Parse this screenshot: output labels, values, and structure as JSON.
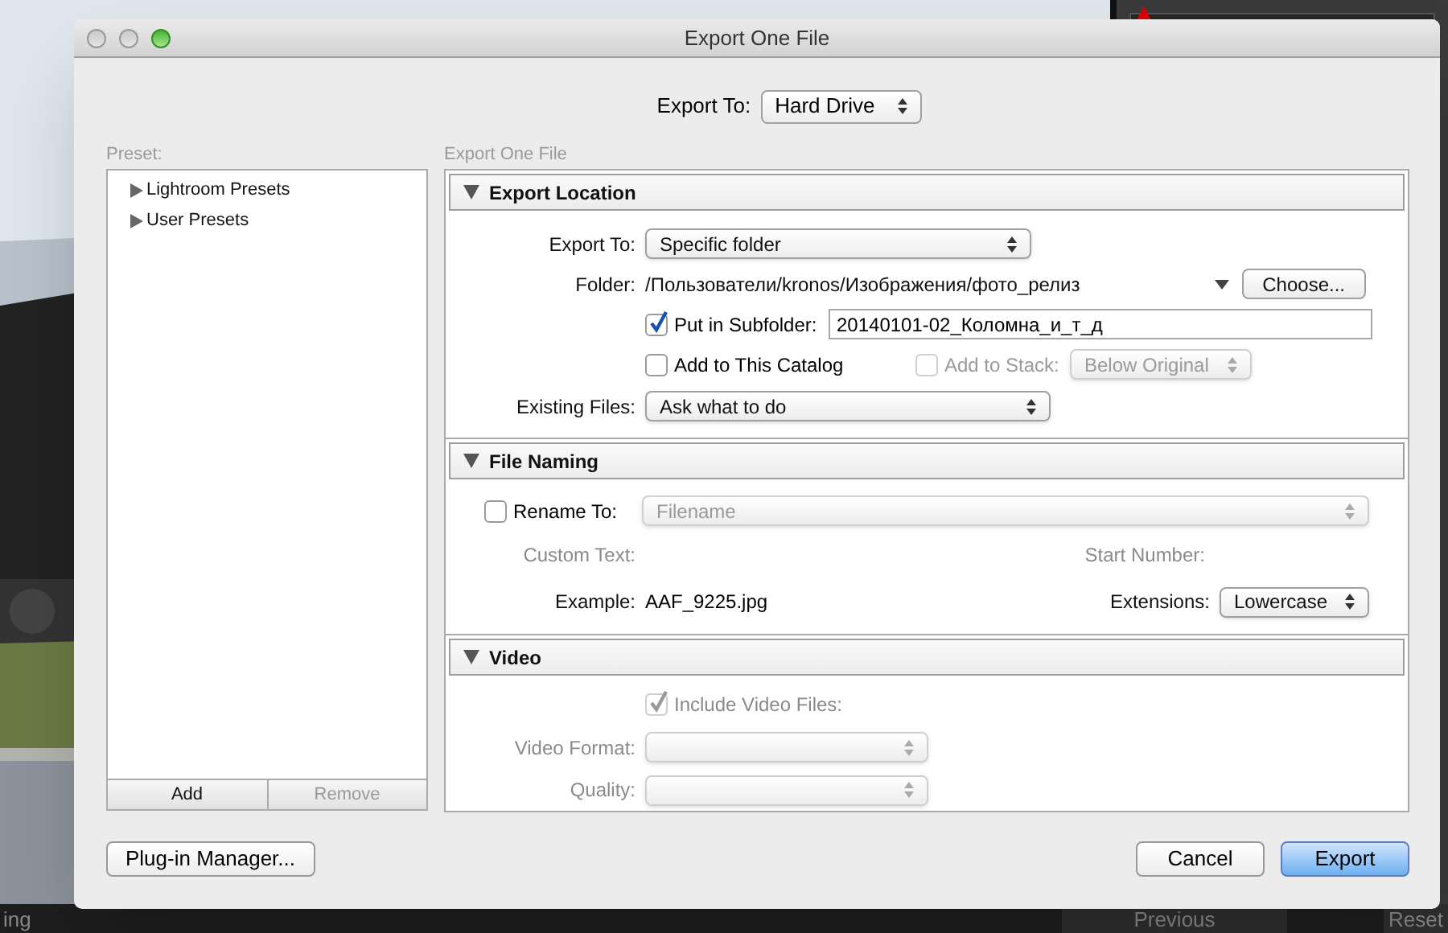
{
  "window": {
    "title": "Export One File"
  },
  "export_to": {
    "label": "Export To:",
    "value": "Hard Drive"
  },
  "preset": {
    "label": "Preset:",
    "items": [
      {
        "label": "Lightroom Presets",
        "expanded": false
      },
      {
        "label": "User Presets",
        "expanded": false
      }
    ],
    "buttons": [
      {
        "label": "Add",
        "disabled": false
      },
      {
        "label": "Remove",
        "disabled": true
      }
    ]
  },
  "panel": {
    "title": "Export One File",
    "sections": [
      {
        "kind": "location",
        "title": "Export Location",
        "expanded": true,
        "export_to": {
          "label": "Export To:",
          "value": "Specific folder"
        },
        "folder": {
          "label": "Folder:",
          "value": "/Пользователи/kronos/Изображения/фото_релиз",
          "button": "Choose..."
        },
        "subfolder": {
          "label": "Put in Subfolder:",
          "checked": true,
          "value": "20140101-02_Коломна_и_т_д"
        },
        "add_to_catalog": {
          "label": "Add to This Catalog",
          "checked": false
        },
        "add_to_stack": {
          "label": "Add to Stack:",
          "checked": false,
          "disabled": true,
          "value": "Below Original"
        },
        "existing_files": {
          "label": "Existing Files:",
          "value": "Ask what to do"
        }
      },
      {
        "kind": "naming",
        "title": "File Naming",
        "expanded": true,
        "rename": {
          "label": "Rename To:",
          "checked": false,
          "value": "Filename",
          "disabled": true
        },
        "custom_text": {
          "label": "Custom Text:",
          "disabled": true
        },
        "start_number": {
          "label": "Start Number:",
          "disabled": true
        },
        "example": {
          "label": "Example:",
          "value": "AAF_9225.jpg"
        },
        "extensions": {
          "label": "Extensions:",
          "value": "Lowercase"
        }
      },
      {
        "kind": "video",
        "title": "Video",
        "expanded": true,
        "include": {
          "label": "Include Video Files:",
          "checked": true,
          "disabled": true
        },
        "video_format": {
          "label": "Video Format:",
          "disabled": true
        },
        "quality": {
          "label": "Quality:",
          "disabled": true
        }
      }
    ]
  },
  "footer": {
    "plugin_button": "Plug-in Manager...",
    "cancel": "Cancel",
    "export": "Export"
  },
  "background": {
    "bottom_bar": [
      "ing",
      "Previous",
      "Reset"
    ]
  }
}
